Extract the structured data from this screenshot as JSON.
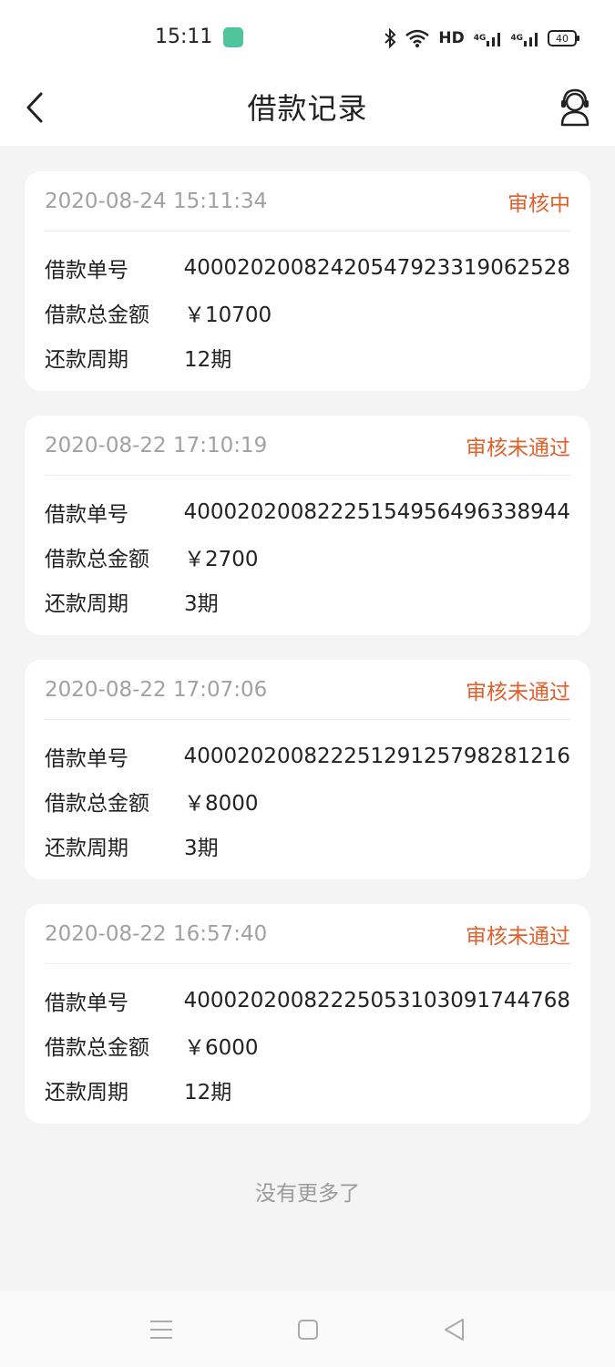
{
  "status_bar": {
    "time": "15:11",
    "network_label": "HD",
    "signal_label_1": "4G",
    "signal_label_2": "4G",
    "battery": "40"
  },
  "header": {
    "title": "借款记录"
  },
  "labels": {
    "order_no": "借款单号",
    "total_amount": "借款总金额",
    "period": "还款周期"
  },
  "records": [
    {
      "date": "2020-08-24 15:11:34",
      "status": "审核中",
      "order_no": "40002020082420547923319062528",
      "amount": "￥10700",
      "period": "12期"
    },
    {
      "date": "2020-08-22 17:10:19",
      "status": "审核未通过",
      "order_no": "40002020082225154956496338944",
      "amount": "￥2700",
      "period": "3期"
    },
    {
      "date": "2020-08-22 17:07:06",
      "status": "审核未通过",
      "order_no": "40002020082225129125798281216",
      "amount": "￥8000",
      "period": "3期"
    },
    {
      "date": "2020-08-22 16:57:40",
      "status": "审核未通过",
      "order_no": "40002020082225053103091744768",
      "amount": "￥6000",
      "period": "12期"
    }
  ],
  "footer": {
    "no_more": "没有更多了"
  },
  "colors": {
    "status_accent": "#e0602c",
    "background": "#f4f4f4"
  }
}
